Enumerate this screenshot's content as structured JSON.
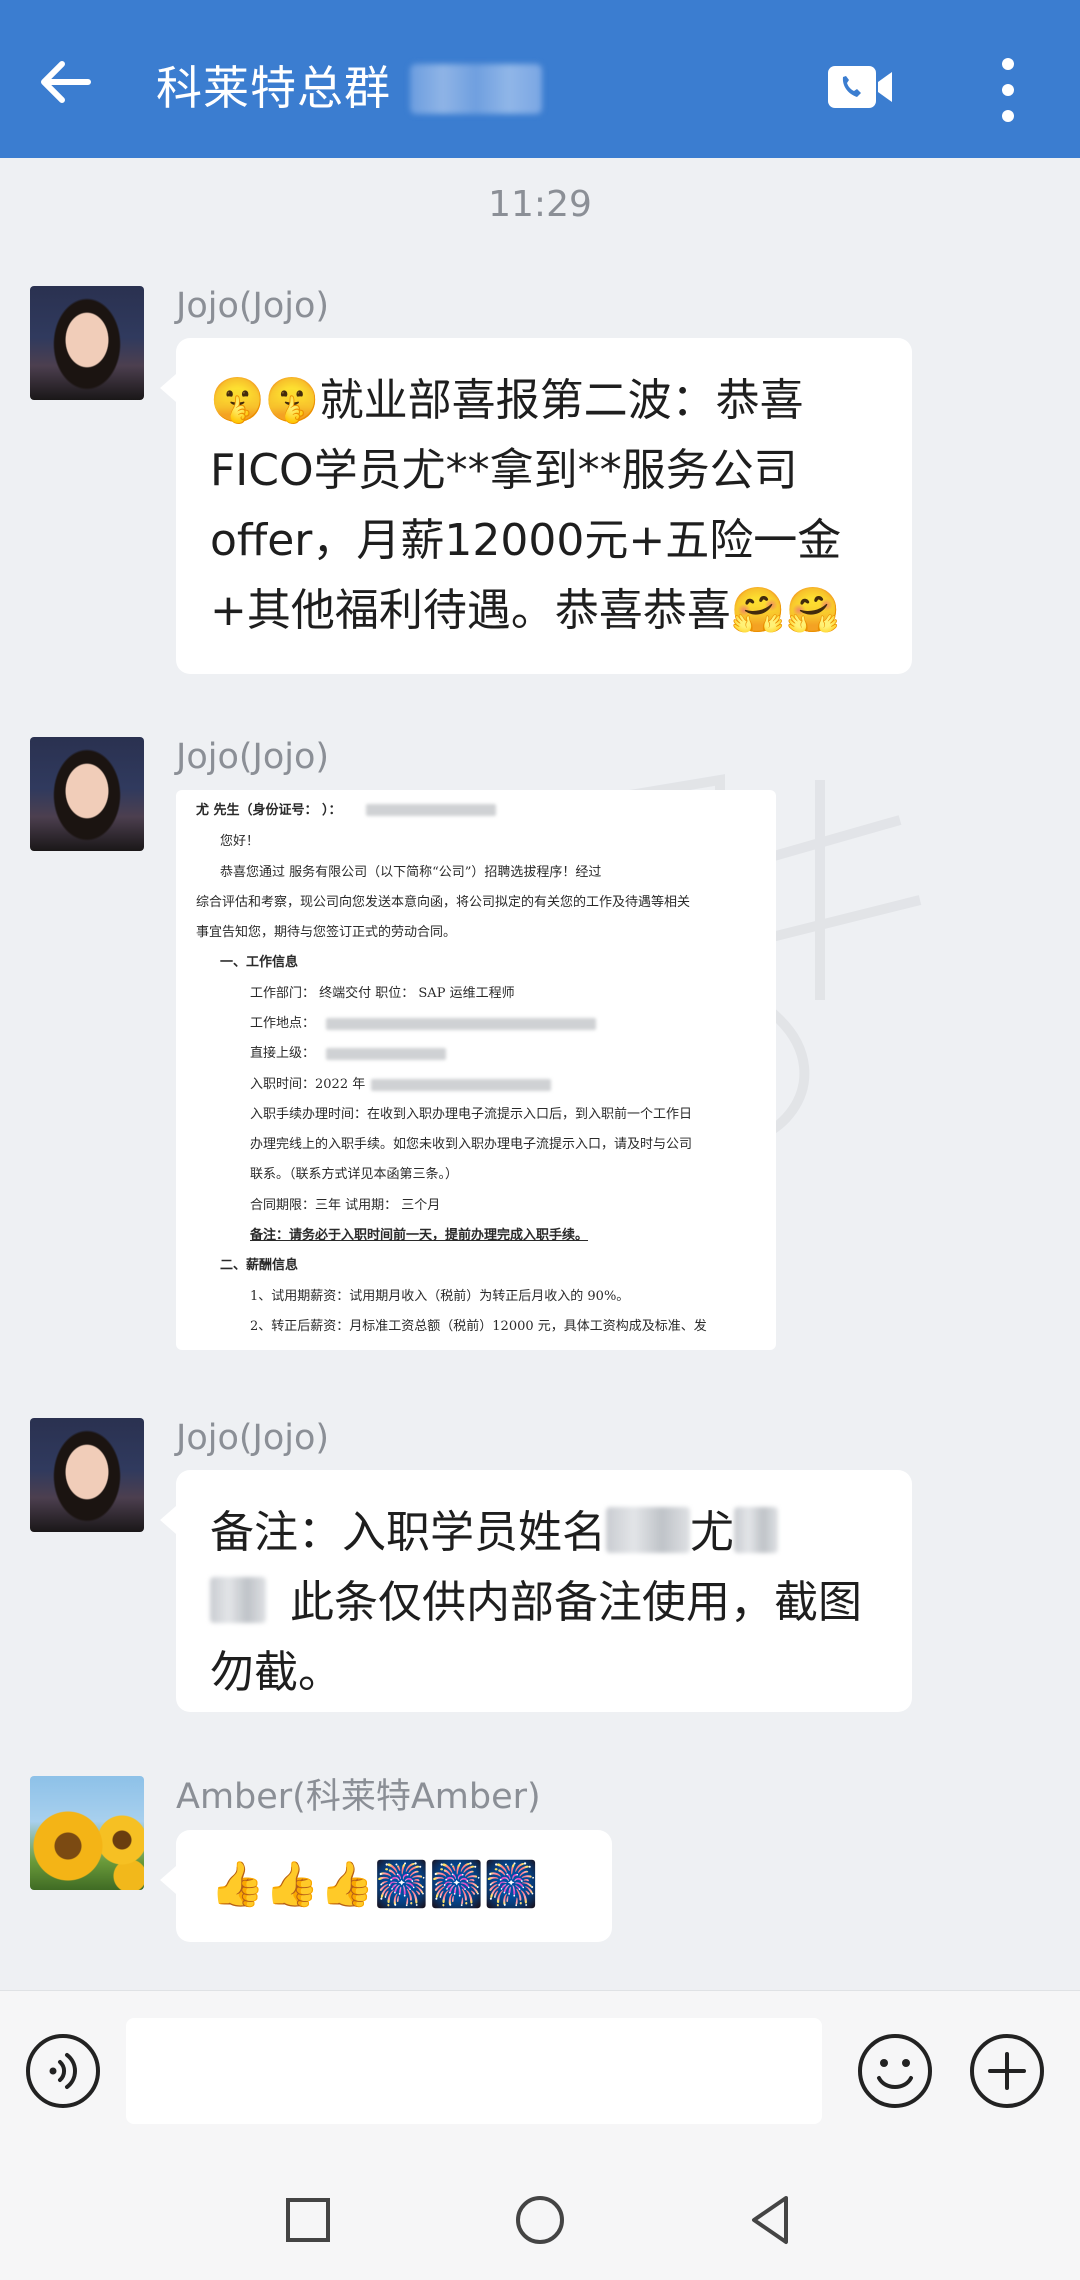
{
  "header": {
    "title": "科莱特总群",
    "icons": {
      "back": "back-arrow-icon",
      "video": "video-call-icon",
      "more": "more-vertical-icon"
    }
  },
  "time_separator": "11:29",
  "messages": [
    {
      "sender": "Jojo(Jojo)",
      "type": "text",
      "text": "🤫🤫就业部喜报第二波：恭喜FICO学员尤**拿到**服务公司offer，月薪12000元+五险一金+其他福利待遇。恭喜恭喜🤗🤗"
    },
    {
      "sender": "Jojo(Jojo)",
      "type": "image",
      "document": {
        "line1": "尤    先生（身份证号：                      ）：",
        "line2": "您好！",
        "line3": "恭喜您通过             服务有限公司（以下简称“公司”）招聘选拔程序！经过",
        "line4": "综合评估和考察，现公司向您发送本意向函，将公司拟定的有关您的工作及待遇等相关",
        "line5": "事宜告知您，期待与您签订正式的劳动合同。",
        "line6": "一、工作信息",
        "line7": "工作部门：  终端交付          职位：  SAP 运维工程师",
        "line8": "工作地点：",
        "line9": "直接上级：",
        "line10": "入职时间：2022 年",
        "line11": "入职手续办理时间：在收到入职办理电子流提示入口后，到入职前一个工作日",
        "line12": "办理完线上的入职手续。如您未收到入职办理电子流提示入口，请及时与公司",
        "line13": "联系。（联系方式详见本函第三条。）",
        "line14": "合同期限：三年                  试用期：     三个月",
        "line15": "备注：请务必于入职时间前一天，提前办理完成入职手续。",
        "line16": "二、薪酬信息",
        "line17": "1、试用期薪资：试用期月收入（税前）为转正后月收入的 90%。",
        "line18": "2、转正后薪资：月标准工资总额（税前）12000 元，具体工资构成及标准、发"
      }
    },
    {
      "sender": "Jojo(Jojo)",
      "type": "text",
      "text_a": "备注：入职学员姓名",
      "text_b": "尤",
      "text_c": "此条仅供内部备注使用，截图勿截。"
    },
    {
      "sender": "Amber(科莱特Amber)",
      "type": "text",
      "text": "👍👍👍🎆🎆🎆"
    }
  ],
  "input": {
    "placeholder": "",
    "icons": [
      "voice-icon",
      "emoji-icon",
      "plus-icon"
    ]
  },
  "navbar": {
    "icons": [
      "recent-apps-icon",
      "home-icon",
      "back-icon"
    ]
  }
}
